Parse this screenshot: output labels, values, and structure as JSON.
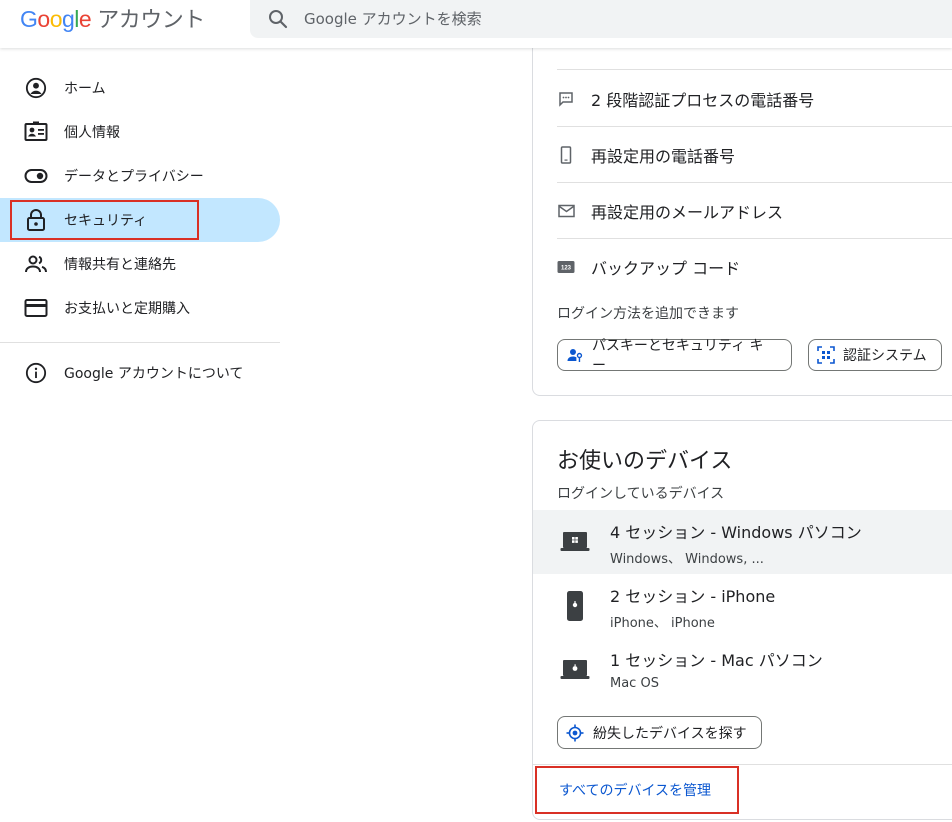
{
  "header": {
    "logo_word": [
      "G",
      "o",
      "o",
      "g",
      "l",
      "e"
    ],
    "product": "アカウント",
    "search_placeholder": "Google アカウントを検索"
  },
  "sidebar": {
    "items": [
      {
        "label": "ホーム",
        "icon": "home-icon"
      },
      {
        "label": "個人情報",
        "icon": "person-card-icon"
      },
      {
        "label": "データとプライバシー",
        "icon": "toggle-icon"
      },
      {
        "label": "セキュリティ",
        "icon": "lock-icon",
        "active": true
      },
      {
        "label": "情報共有と連絡先",
        "icon": "people-icon"
      },
      {
        "label": "お支払いと定期購入",
        "icon": "credit-card-icon"
      }
    ],
    "about": {
      "label": "Google アカウントについて",
      "icon": "info-icon"
    }
  },
  "signin": {
    "rows": [
      {
        "label": "2 段階認証プロセスの電話番号",
        "icon": "sms-icon"
      },
      {
        "label": "再設定用の電話番号",
        "icon": "phone-icon"
      },
      {
        "label": "再設定用のメールアドレス",
        "icon": "mail-icon"
      },
      {
        "label": "バックアップ コード",
        "icon": "backup-code-icon"
      }
    ],
    "add_label": "ログイン方法を追加できます",
    "passkey_label": "パスキーとセキュリティ キー",
    "authenticator_label": "認証システム"
  },
  "devices": {
    "title": "お使いのデバイス",
    "subtitle": "ログインしているデバイス",
    "list": [
      {
        "name": "4 セッション - Windows パソコン",
        "detail": "Windows、 Windows, ...",
        "icon": "windows-laptop-icon"
      },
      {
        "name": "2 セッション - iPhone",
        "detail": "iPhone、 iPhone",
        "icon": "iphone-icon"
      },
      {
        "name": "1 セッション - Mac パソコン",
        "detail": "Mac OS",
        "icon": "mac-laptop-icon"
      }
    ],
    "find_label": "紛失したデバイスを探す",
    "manage_label": "すべてのデバイスを管理"
  },
  "colors": {
    "accent": "#0b57d0",
    "active_nav": "#c2e7ff",
    "highlight_border": "#d93025"
  }
}
